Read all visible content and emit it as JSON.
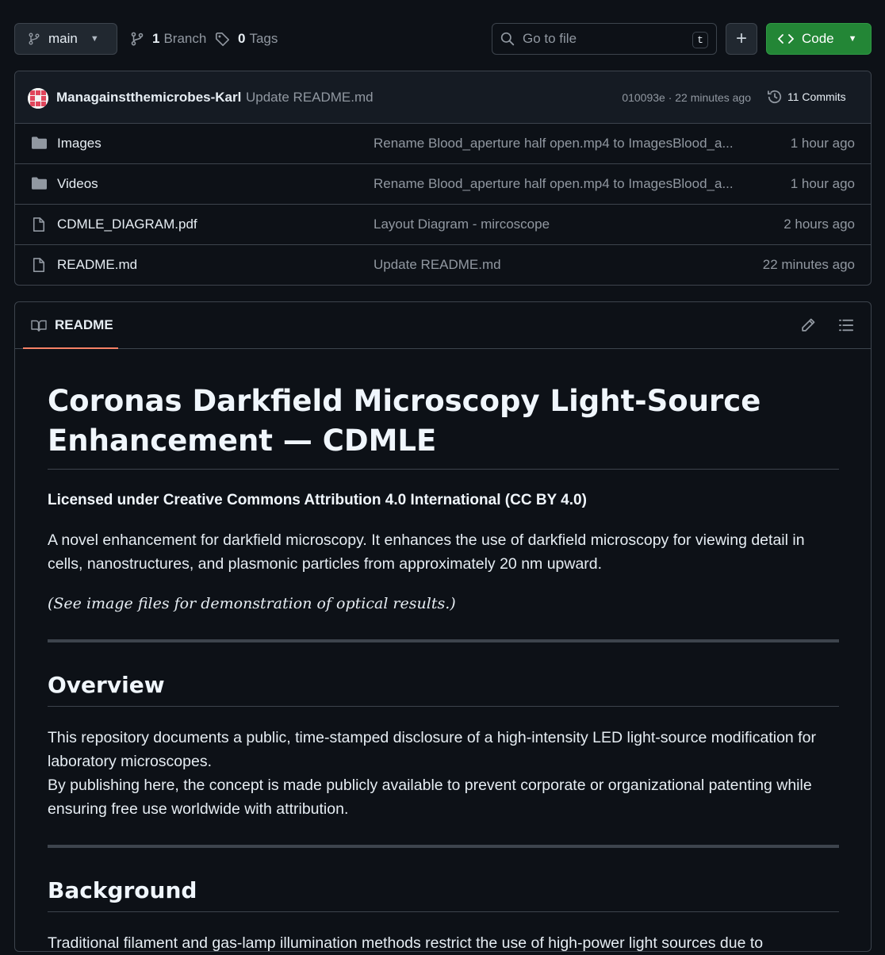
{
  "toolbar": {
    "branch_name": "main",
    "branches_count": "1",
    "branches_label": "Branch",
    "tags_count": "0",
    "tags_label": "Tags",
    "search_placeholder": "Go to file",
    "search_shortcut": "t",
    "code_label": "Code"
  },
  "latest_commit": {
    "author": "Managainstthemicrobes-Karl",
    "message": "Update README.md",
    "hash_time": "010093e · 22 minutes ago",
    "commits_label": "11 Commits"
  },
  "files": [
    {
      "name": "Images",
      "type": "folder",
      "message": "Rename Blood_aperture half open.mp4 to ImagesBlood_a...",
      "time": "1 hour ago"
    },
    {
      "name": "Videos",
      "type": "folder",
      "message": "Rename Blood_aperture half open.mp4 to ImagesBlood_a...",
      "time": "1 hour ago"
    },
    {
      "name": "CDMLE_DIAGRAM.pdf",
      "type": "file",
      "message": "Layout Diagram - mircoscope",
      "time": "2 hours ago"
    },
    {
      "name": "README.md",
      "type": "file",
      "message": "Update README.md",
      "time": "22 minutes ago"
    }
  ],
  "readme": {
    "tab_label": "README",
    "title": "Coronas Darkfield Microscopy Light-Source Enhancement — CDMLE",
    "license": "Licensed under Creative Commons Attribution 4.0 International (CC BY 4.0)",
    "intro": "A novel enhancement for darkfield microscopy. It enhances the use of darkfield microscopy for viewing detail in cells, nanostructures, and plasmonic particles from approximately 20 nm upward.",
    "note": "(See image files for demonstration of optical results.)",
    "overview_heading": "Overview",
    "overview_p1": "This repository documents a public, time-stamped disclosure of a high-intensity LED light-source modification for laboratory microscopes.",
    "overview_p2": "By publishing here, the concept is made publicly available to prevent corporate or organizational patenting while ensuring free use worldwide with attribution.",
    "background_heading": "Background",
    "background_p1": "Traditional filament and gas-lamp illumination methods restrict the use of high-power light sources due to"
  }
}
